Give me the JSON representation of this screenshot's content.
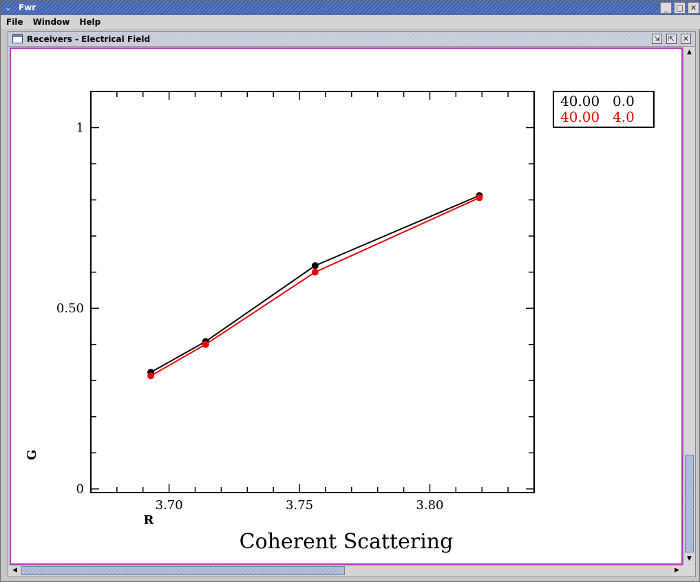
{
  "window": {
    "title": "Fwr",
    "menu_icon": "chevron-down-icon",
    "buttons": [
      "_",
      "□",
      "✕"
    ]
  },
  "menubar": {
    "items": [
      "File",
      "Window",
      "Help"
    ]
  },
  "internal_frame": {
    "title": "Receivers - Electrical Field",
    "buttons": [
      "⇲",
      "⇱",
      "✕"
    ]
  },
  "chart_data": {
    "type": "line",
    "title": "Coherent Scattering",
    "xlabel": "R",
    "ylabel": "G",
    "xlim": [
      3.67,
      3.84
    ],
    "ylim": [
      -0.01,
      1.1
    ],
    "xticks": [
      3.7,
      3.75,
      3.8
    ],
    "xtick_labels": [
      "3.70",
      "3.75",
      "3.80"
    ],
    "yticks": [
      0,
      0.5,
      1
    ],
    "ytick_labels": [
      "0",
      "0.50",
      "1"
    ],
    "legend_position": "top-right-outside",
    "grid": false,
    "series": [
      {
        "name": "40.00   0.0",
        "color": "#000000",
        "x": [
          3.693,
          3.714,
          3.756,
          3.819
        ],
        "y": [
          0.323,
          0.408,
          0.618,
          0.812
        ]
      },
      {
        "name": "40.00   4.0",
        "color": "#ee0000",
        "x": [
          3.693,
          3.714,
          3.756,
          3.819
        ],
        "y": [
          0.313,
          0.4,
          0.6,
          0.806
        ]
      }
    ]
  }
}
